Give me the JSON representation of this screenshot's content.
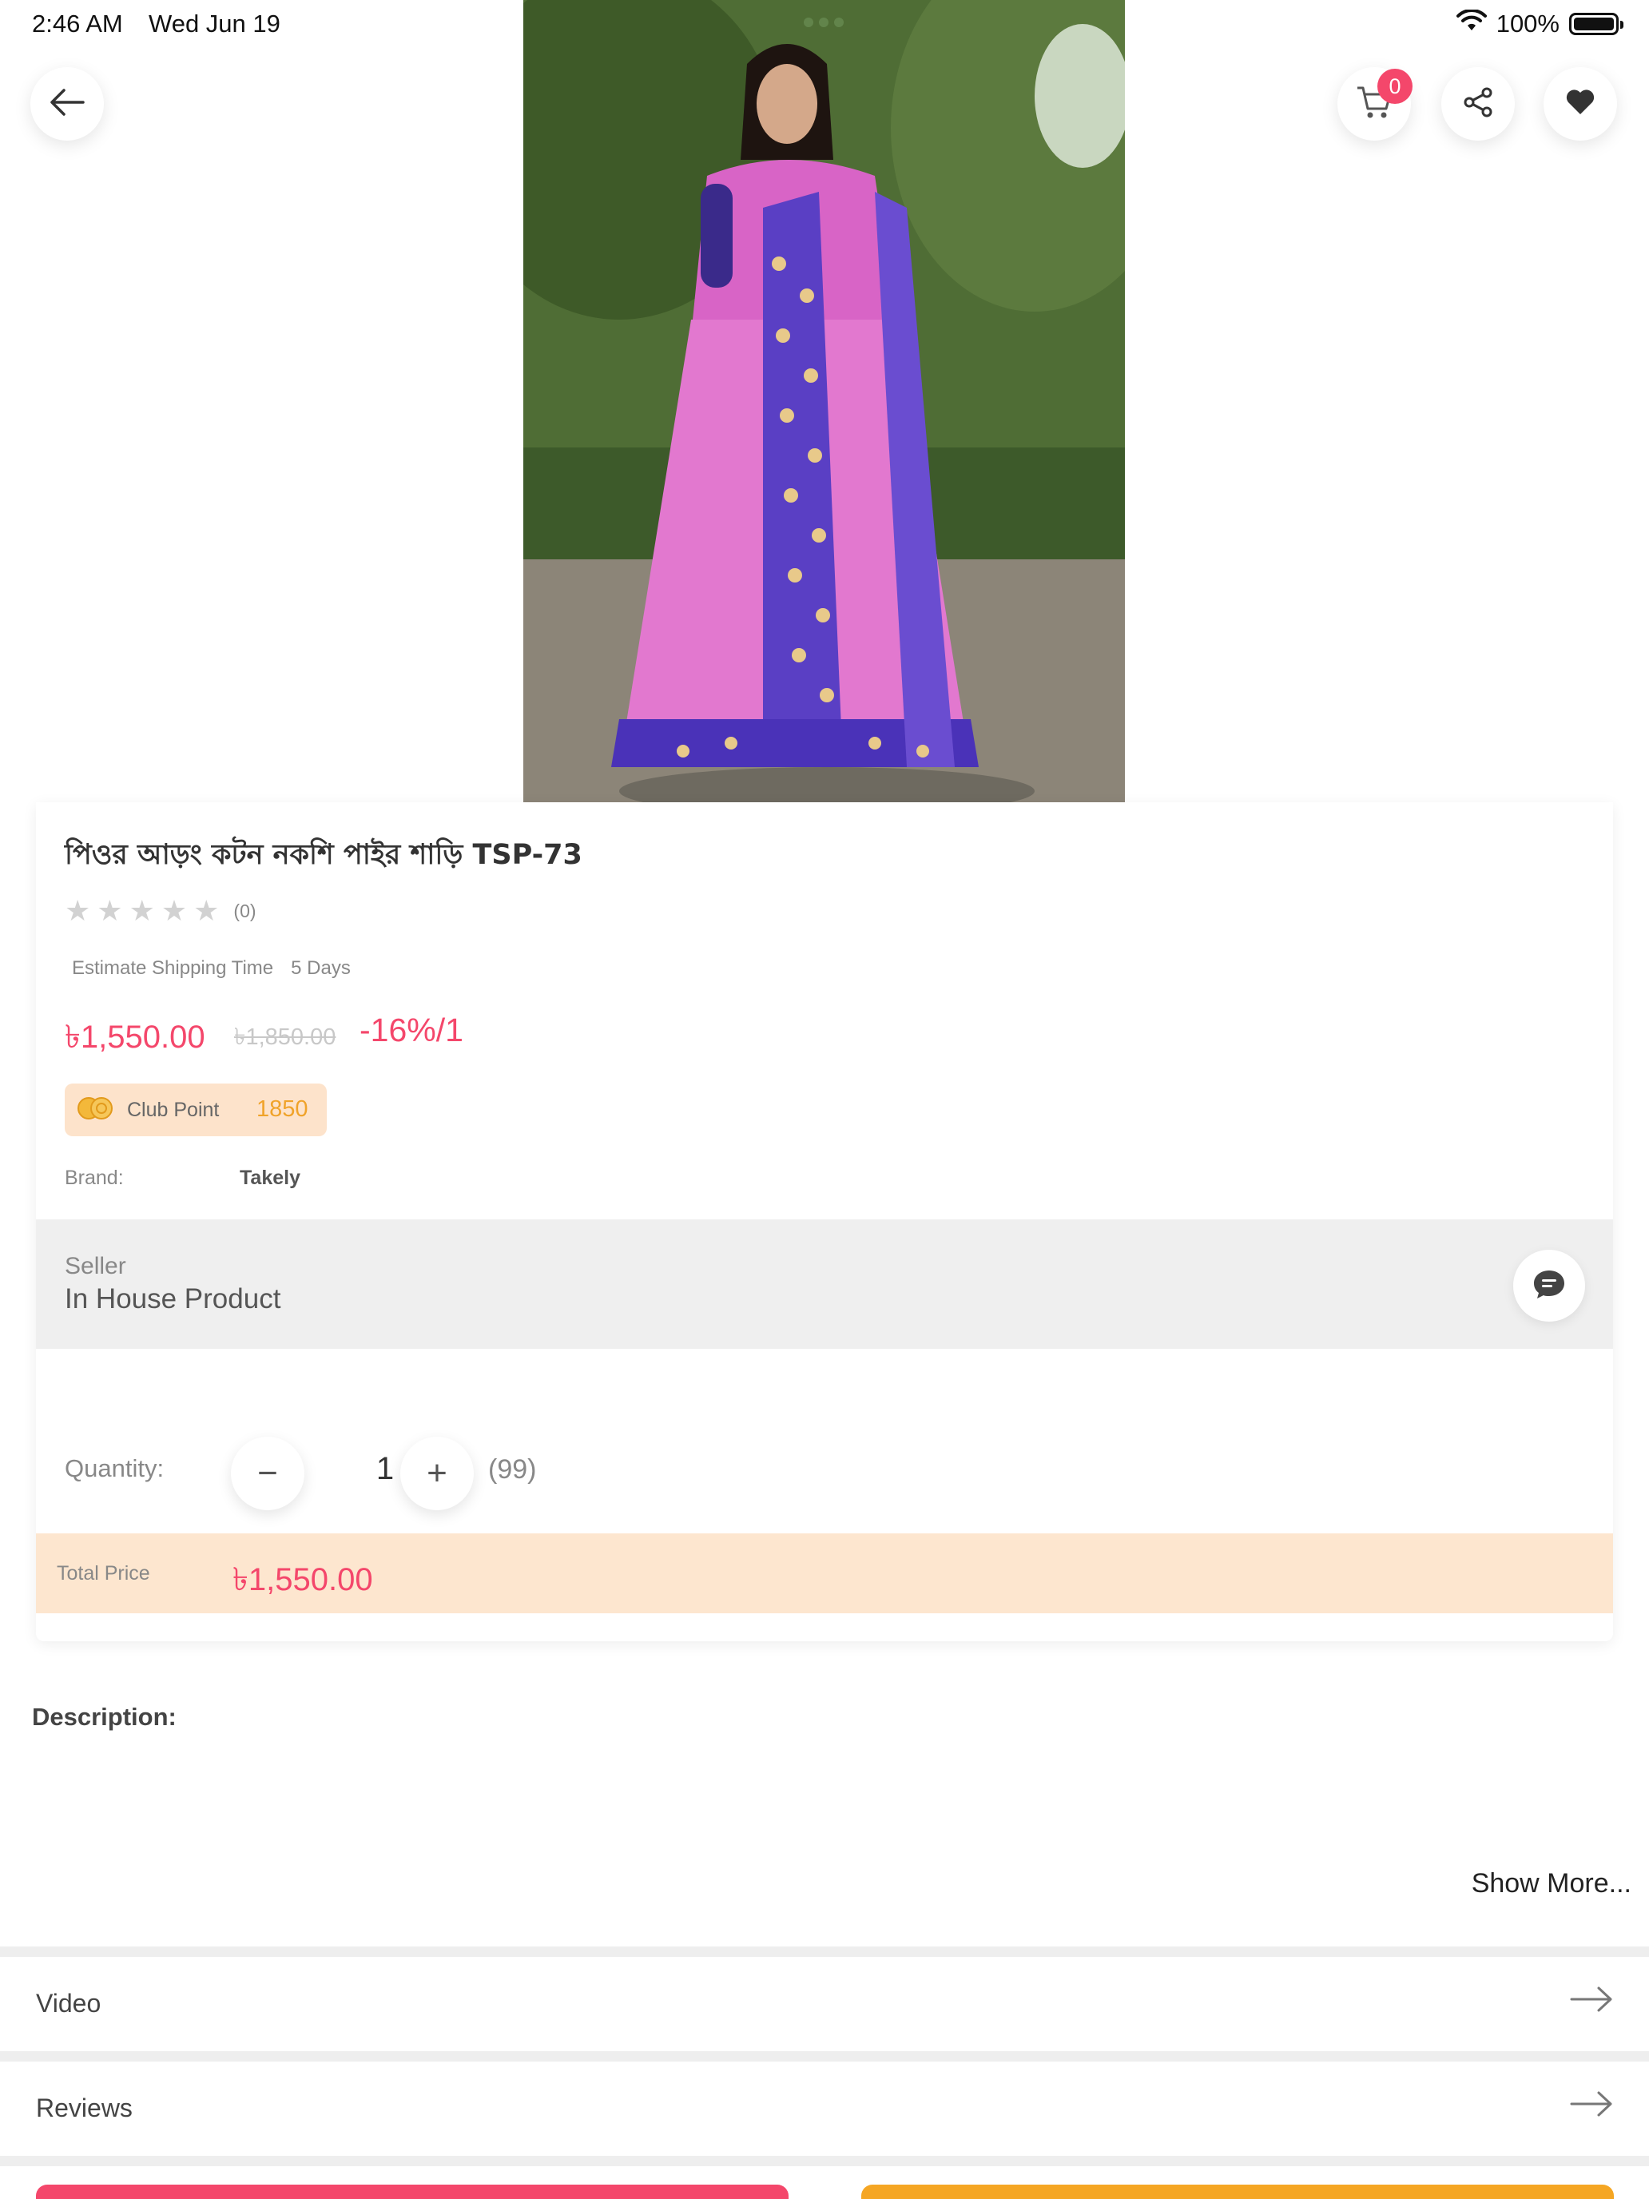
{
  "status_bar": {
    "time": "2:46 AM",
    "date": "Wed Jun 19",
    "battery": "100%",
    "icons": [
      "wifi-icon",
      "battery-icon"
    ]
  },
  "header": {
    "back_icon": "arrow-left-icon",
    "cart_icon": "cart-icon",
    "cart_count": "0",
    "share_icon": "share-icon",
    "wishlist_icon": "heart-icon"
  },
  "product": {
    "title": "পিওর আড়ং কটন নকশি পাইর শাড়ি TSP-73",
    "rating_count": "(0)",
    "rating": 0,
    "rating_max": 5,
    "shipping_label": "Estimate Shipping Time",
    "shipping_value": "5 Days",
    "price": "৳1,550.00",
    "old_price": "৳1,850.00",
    "discount": "-16%/1",
    "club_point_label": "Club Point",
    "club_point_value": "1850",
    "brand_label": "Brand:",
    "brand_value": "Takely"
  },
  "seller": {
    "label": "Seller",
    "value": "In House Product",
    "chat_icon": "chat-icon"
  },
  "quantity": {
    "label": "Quantity:",
    "value": "1",
    "decrement": "−",
    "increment": "+",
    "stock": "(99)"
  },
  "total": {
    "label": "Total Price",
    "value": "৳1,550.00"
  },
  "description": {
    "title": "Description:",
    "show_more": "Show More..."
  },
  "sections": [
    {
      "label": "Video",
      "icon": "arrow-right-icon"
    },
    {
      "label": "Reviews",
      "icon": "arrow-right-icon"
    }
  ],
  "colors": {
    "accent_pink": "#f4476b",
    "accent_orange": "#f5a623",
    "club_bg": "#fde3cb",
    "total_bg": "#fde6cf"
  }
}
